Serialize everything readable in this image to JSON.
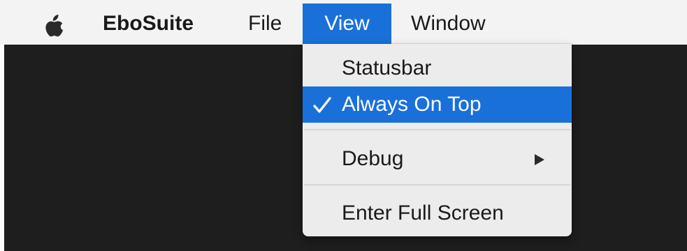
{
  "menubar": {
    "apple_icon": "apple-logo-icon",
    "app_name": "EboSuite",
    "menus": [
      "File",
      "View",
      "Window"
    ],
    "active_menu": "View"
  },
  "view_menu": {
    "items": [
      {
        "label": "Statusbar",
        "checked": false,
        "highlighted": false
      },
      {
        "label": "Always On Top",
        "checked": true,
        "highlighted": true
      },
      {
        "label": "Debug",
        "has_submenu": true
      },
      {
        "label": "Enter Full Screen"
      }
    ],
    "check_icon": "checkmark-icon",
    "submenu_icon": "triangle-right-icon"
  },
  "colors": {
    "highlight": "#1a70d9",
    "menubar": "#f3f3f3",
    "menu_background": "#ececec",
    "desktop": "#1e1e1e"
  }
}
